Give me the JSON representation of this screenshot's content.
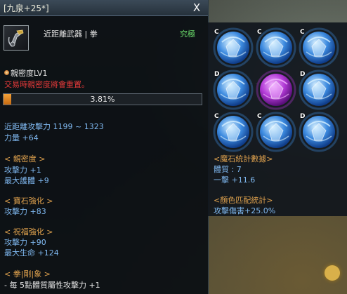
{
  "tooltip": {
    "title": "[九泉+25*]",
    "close_label": "X",
    "item_type": "近距離武器 | 拳",
    "grade": "究極",
    "affinity_label": "親密度LV1",
    "warning": "交易時親密度將會重置。",
    "progress_text": "3.81%",
    "progress_value": 3.81,
    "attack_line": "近距離攻擊力 1199 ~ 1323",
    "strength_line": "力量 +64",
    "sections": {
      "affinity": {
        "header": "< 親密度 >",
        "lines": [
          "攻擊力 +1",
          "最大護體 +9"
        ]
      },
      "gem": {
        "header": "< 寶石強化 >",
        "lines": [
          "攻擊力 +83"
        ]
      },
      "blessing": {
        "header": "< 祝福強化 >",
        "lines": [
          "攻擊力 +90",
          "最大生命 +124"
        ]
      },
      "style": {
        "header": "< 拳|剛|象 >",
        "lines": [
          "- 每 5點體質屬性攻擊力 +1"
        ]
      }
    }
  },
  "gem_panel": {
    "slots": [
      {
        "letter": "C",
        "color": "blue"
      },
      {
        "letter": "C",
        "color": "blue"
      },
      {
        "letter": "C",
        "color": "blue"
      },
      {
        "letter": "D",
        "color": "blue"
      },
      {
        "letter": "",
        "color": "purple"
      },
      {
        "letter": "D",
        "color": "blue"
      },
      {
        "letter": "C",
        "color": "blue"
      },
      {
        "letter": "C",
        "color": "blue"
      },
      {
        "letter": "D",
        "color": "blue"
      }
    ],
    "stats_header": "<魔石統計數據>",
    "stats_lines": [
      "體質 : 7",
      "一擊 +11.6"
    ],
    "color_header": "<顏色匹配統計>",
    "color_lines": [
      "攻擊傷害+25.0%"
    ]
  },
  "colors": {
    "blue_text": "#7fb8f0",
    "header_text": "#e0a24e",
    "warning": "#e63a3a",
    "grade": "#6bdd6b",
    "progress": "#f3a23a"
  }
}
